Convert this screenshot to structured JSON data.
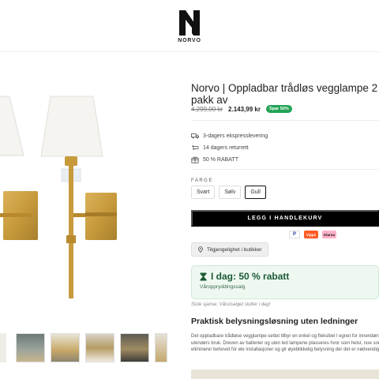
{
  "brand": {
    "name": "NORVO",
    "logo": "norvo-n-logo"
  },
  "product": {
    "title": "Norvo | Oppladbar trådløs vegglampe 2 pakk av",
    "old_price": "4.299,00 kr",
    "new_price": "2.143,99 kr",
    "save_badge": "Spar 50%"
  },
  "features": [
    {
      "icon": "truck-icon",
      "text": "3-dagers ekspresslevering"
    },
    {
      "icon": "return-icon",
      "text": "14 dagers returrett"
    },
    {
      "icon": "gift-icon",
      "text": "50 % RABATT"
    }
  ],
  "variants": {
    "label": "FARGE",
    "options": [
      "Svart",
      "Sølv",
      "Gull"
    ],
    "selected": "Gull"
  },
  "cart_button": "LEGG I HANDLEKURV",
  "payments": {
    "paypal": "P",
    "vipps": "Vipps",
    "klarna": "Klarna"
  },
  "store_button": "Tilgjengelighet i butikker",
  "promo": {
    "headline": "I dag: 50 % rabatt",
    "sub": "Våroppryddingssalg"
  },
  "last_chance": "Siste sjanse: Vårutsalget slutter i dag!",
  "section_title": "Praktisk belysningsløsning uten ledninger",
  "description": "Det oppladbare trådløse vegglampe-settet tilbyr en enkel og fleksibel l egnet for innendørs og utendørs bruk. Dreven av batterier og uten led lampene plasseres hvor som helst, noe som eliminerer behovet for ele installasjoner og gir øyeblikkelig belysning der det er nødvendig.",
  "colors": {
    "brass": "#c79a3c",
    "shade": "#f6f4f0",
    "promo_bg": "#eef8f1",
    "promo_text": "#1c5a35",
    "save_green": "#22a455",
    "cart_bg": "#000000"
  }
}
